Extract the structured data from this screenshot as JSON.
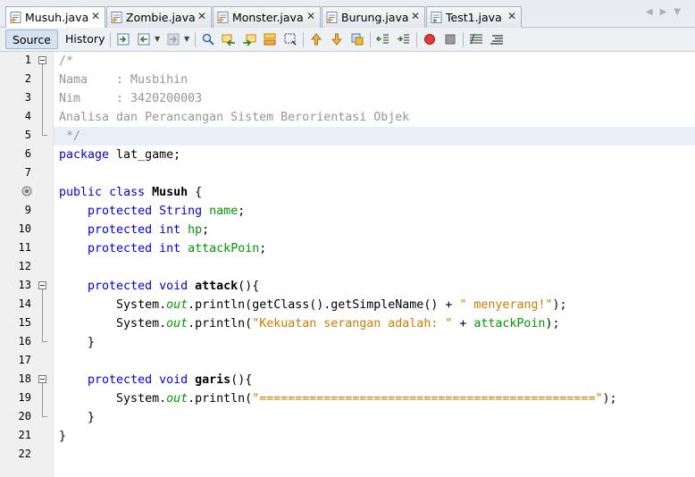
{
  "tabs": [
    {
      "label": "Musuh.java",
      "active": true
    },
    {
      "label": "Zombie.java",
      "active": false
    },
    {
      "label": "Monster.java",
      "active": false
    },
    {
      "label": "Burung.java",
      "active": false
    },
    {
      "label": "Test1.java",
      "active": false
    }
  ],
  "close_glyph": "✕",
  "toolbar": {
    "source": "Source",
    "history": "History"
  },
  "colors": {
    "keyword": "#0000e6",
    "comment": "#969696",
    "field": "#009900",
    "string": "#ce7b00",
    "current_line": "#e9eff8"
  },
  "line_numbers": [
    "1",
    "2",
    "3",
    "4",
    "5",
    "6",
    "7",
    "8",
    "9",
    "10",
    "11",
    "12",
    "13",
    "14",
    "15",
    "16",
    "17",
    "18",
    "19",
    "20",
    "21",
    "22"
  ],
  "code": {
    "c1": "/*",
    "c2": "Nama    : Musbihin",
    "c3": "Nim     : 3420200003",
    "c4": "Analisa dan Perancangan Sistem Berorientasi Objek",
    "c5": " */",
    "kw_package": "package",
    "pkg_name": " lat_game;",
    "kw_public": "public",
    "kw_class": "class",
    "class_name": "Musuh",
    "open_brace": " {",
    "kw_protected": "protected",
    "type_string": "String",
    "type_int": "int",
    "kw_void": "void",
    "f_name": "name",
    "f_hp": "hp",
    "f_attack": "attackPoin",
    "semi": ";",
    "m_attack": "attack",
    "m_garis": "garis",
    "paren_open": "(){",
    "sys": "System.",
    "out": "out",
    "println_open": ".println(",
    "getclass": "getClass().getSimpleName() + ",
    "s_menyerang": "\" menyerang!\"",
    "close_call": ");",
    "s_kekuatan": "\"Kekuatan serangan adalah: \"",
    "plus": " + ",
    "s_garis": "\"===============================================\"",
    "close_brace": "}"
  }
}
